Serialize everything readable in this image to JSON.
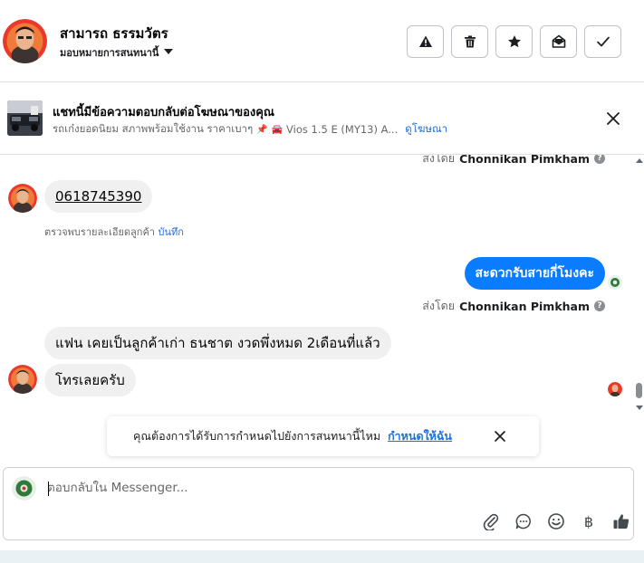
{
  "header": {
    "contact_name": "สามารถ ธรรมวัตร",
    "assign_label": "มอบหมายการสนทนานี้",
    "actions": [
      {
        "icon": "warning-icon"
      },
      {
        "icon": "trash-icon"
      },
      {
        "icon": "star-icon"
      },
      {
        "icon": "envelope-open-icon"
      },
      {
        "icon": "check-icon"
      }
    ]
  },
  "ad_banner": {
    "title": "แชทนี้มีข้อความตอบกลับต่อโฆษณาของคุณ",
    "subtitle": "รถเก๋งยอดนิยม สภาพพร้อมใช้งาน ราคาเบาๆ",
    "pin_emoji": "📌",
    "car_emoji": "🚘",
    "model_text": "Vios 1.5 E (MY13) A...",
    "link_label": "ดูโฆษณา"
  },
  "thread": {
    "sent_by_prefix": "ส่งโดย",
    "agent_name": "Chonnikan Pimkham",
    "phone_message": "0618745390",
    "note_text": "ตรวจพบรายละเอียดลูกค้า",
    "note_link": "บันทึก",
    "outgoing_message": "สะดวกรับสายกี่โมงคะ",
    "incoming_message_1": "แฟน เคยเป็นลูกค้าเก่า ธนชาต งวดพึ่งหมด 2เดือนที่แล้ว",
    "incoming_message_2": "โทรเลยครับ"
  },
  "toast": {
    "text": "คุณต้องการได้รับการกำหนดไปยังการสนทนานี้ไหม",
    "link": "กำหนดให้ฉัน"
  },
  "composer": {
    "placeholder": "ตอบกลับใน Messenger...",
    "tools": [
      "paperclip-icon",
      "saved-reply-icon",
      "emoji-icon",
      "baht-icon",
      "thumbs-up-icon"
    ],
    "baht_symbol": "฿"
  },
  "colors": {
    "accent": "#0a7cff",
    "link": "#216fdb",
    "bubble_in": "#f0f0f0"
  }
}
